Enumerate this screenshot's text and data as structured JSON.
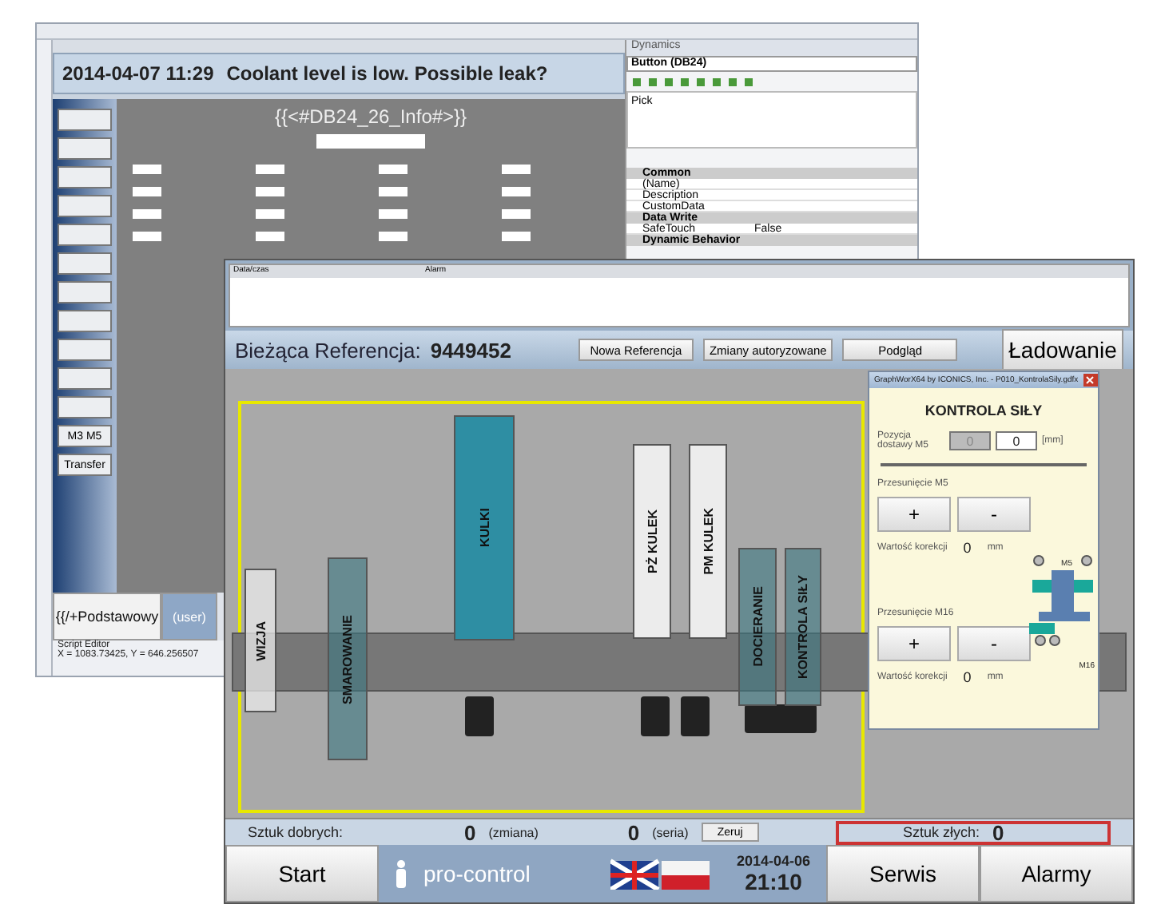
{
  "editor": {
    "alarm_date": "2014-04-07 11:29",
    "alarm_text": "Coolant level is low.  Possible leak?",
    "screen_title": "{{<#DB24_26_Info#>}}",
    "side_buttons": [
      "M3 M5",
      "Transfer"
    ],
    "footer_tabs": [
      "{{/+Podstawowy",
      "(user)"
    ],
    "script_tab": "Script Editor",
    "coords": "X = 1083.73425, Y = 646.256507"
  },
  "dynamics": {
    "title": "Dynamics",
    "object": "Button (DB24)",
    "actions": [
      "Pick"
    ],
    "groups": [
      {
        "name": "Common",
        "rows": [
          {
            "name": "(Name)",
            "value": ""
          },
          {
            "name": "Description",
            "value": ""
          },
          {
            "name": "CustomData",
            "value": ""
          }
        ]
      },
      {
        "name": "Data Write",
        "rows": [
          {
            "name": "SafeTouch",
            "value": "False"
          }
        ]
      },
      {
        "name": "Dynamic Behavior"
      }
    ]
  },
  "hmi": {
    "alarm_columns": [
      "Data/czas",
      "Alarm"
    ],
    "reference_label": "Bieżąca Referencja:",
    "reference_value": "9449452",
    "buttons": [
      "Nowa Referencja",
      "Zmiany autoryzowane",
      "Podgląd"
    ],
    "load_button": "Ładowanie",
    "stations": [
      {
        "name": "WIZJA",
        "kind": "grey"
      },
      {
        "name": "SMAROWANIE",
        "kind": "overlay"
      },
      {
        "name": "KULKI",
        "kind": "teal"
      },
      {
        "name": "PŻ KULEK",
        "kind": "white"
      },
      {
        "name": "PM KULEK",
        "kind": "white"
      },
      {
        "name": "DOCIERANIE",
        "kind": "overlay"
      },
      {
        "name": "KONTROLA SIŁY",
        "kind": "overlay"
      }
    ],
    "counters": {
      "good_label": "Sztuk dobrych:",
      "shift_value": "0",
      "shift_label": "(zmiana)",
      "series_value": "0",
      "series_label": "(seria)",
      "reset": "Zeruj",
      "bad_label": "Sztuk złych:",
      "bad_value": "0"
    },
    "nav": {
      "start": "Start",
      "user": "pro-control",
      "date": "2014-04-06",
      "time": "21:10",
      "service": "Serwis",
      "alarms": "Alarmy"
    }
  },
  "popup": {
    "title": "GraphWorX64 by ICONICS, Inc. - P010_KontrolaSily.gdfx",
    "heading": "KONTROLA SIŁY",
    "position_label": "Pozycja dostawy M5",
    "position_actual": "0",
    "position_set": "0",
    "position_unit": "[mm]",
    "sections": [
      {
        "label": "Przesunięcie M5",
        "plus": "+",
        "minus": "-",
        "correction_label": "Wartość korekcji",
        "correction_value": "0",
        "unit": "mm"
      },
      {
        "label": "Przesunięcie M16",
        "plus": "+",
        "minus": "-",
        "correction_label": "Wartość korekcji",
        "correction_value": "0",
        "unit": "mm"
      }
    ],
    "m5_label": "M5",
    "m16_label": "M16"
  }
}
